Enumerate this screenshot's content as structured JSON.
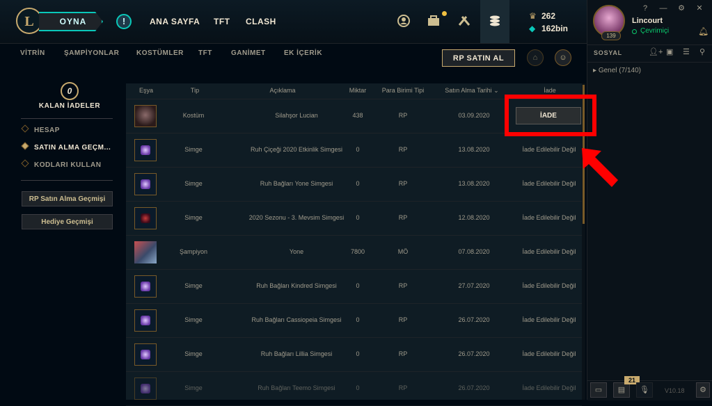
{
  "topbar": {
    "logo_letter": "L",
    "play_label": "OYNA",
    "alert_symbol": "!",
    "nav": [
      "ANA SAYFA",
      "TFT",
      "CLASH"
    ],
    "icons": [
      "profile-icon",
      "collection-icon",
      "loot-icon",
      "store-icon"
    ],
    "currency": {
      "blue_essence": "262",
      "rp": "162bin"
    }
  },
  "profile": {
    "name": "Lincourt",
    "status": "Çevrimiçi",
    "level": "139",
    "sys_buttons": [
      "?",
      "—",
      "⚙",
      "✕"
    ]
  },
  "subnav": {
    "items": [
      "VİTRİN",
      "ŞAMPİYONLAR",
      "KOSTÜMLER",
      "TFT",
      "GANİMET",
      "EK İÇERİK"
    ],
    "buy_rp": "RP SATIN AL"
  },
  "social": {
    "title": "SOSYAL",
    "group": "Genel (7/140)",
    "badge_count": "21",
    "version": "V10.18"
  },
  "left": {
    "refund_count": "0",
    "refund_label": "KALAN İADELER",
    "nav": [
      {
        "label": "HESAP"
      },
      {
        "label": "SATIN ALMA GEÇM..."
      },
      {
        "label": "KODLARI KULLAN"
      }
    ],
    "buttons": [
      "RP Satın Alma Geçmişi",
      "Hediye Geçmişi"
    ]
  },
  "table": {
    "headers": [
      "Eşya",
      "Tip",
      "Açıklama",
      "Miktar",
      "Para Birimi Tipi",
      "Satın Alma Tarihi",
      "İade"
    ],
    "refund_button": "İADE",
    "rows": [
      {
        "thumb": "skin",
        "type": "Kostüm",
        "desc": "Silahşor Lucian",
        "amount": "438",
        "currency": "RP",
        "date": "03.09.2020",
        "status": ""
      },
      {
        "thumb": "icon",
        "type": "Simge",
        "desc": "Ruh Çiçeği 2020 Etkinlik Simgesi",
        "amount": "0",
        "currency": "RP",
        "date": "13.08.2020",
        "status": "İade Edilebilir Değil"
      },
      {
        "thumb": "icon",
        "type": "Simge",
        "desc": "Ruh Bağları Yone Simgesi",
        "amount": "0",
        "currency": "RP",
        "date": "13.08.2020",
        "status": "İade Edilebilir Değil"
      },
      {
        "thumb": "icon red",
        "type": "Simge",
        "desc": "2020 Sezonu - 3. Mevsim Simgesi",
        "amount": "0",
        "currency": "RP",
        "date": "12.08.2020",
        "status": "İade Edilebilir Değil"
      },
      {
        "thumb": "champ",
        "type": "Şampiyon",
        "desc": "Yone",
        "amount": "7800",
        "currency": "MÖ",
        "date": "07.08.2020",
        "status": "İade Edilebilir Değil"
      },
      {
        "thumb": "icon",
        "type": "Simge",
        "desc": "Ruh Bağları Kindred Simgesi",
        "amount": "0",
        "currency": "RP",
        "date": "27.07.2020",
        "status": "İade Edilebilir Değil"
      },
      {
        "thumb": "icon",
        "type": "Simge",
        "desc": "Ruh Bağları Cassiopeia Simgesi",
        "amount": "0",
        "currency": "RP",
        "date": "26.07.2020",
        "status": "İade Edilebilir Değil"
      },
      {
        "thumb": "icon",
        "type": "Simge",
        "desc": "Ruh Bağları Lillia Simgesi",
        "amount": "0",
        "currency": "RP",
        "date": "26.07.2020",
        "status": "İade Edilebilir Değil"
      },
      {
        "thumb": "icon",
        "type": "Simge",
        "desc": "Ruh Bağları Teemo Simgesi",
        "amount": "0",
        "currency": "RP",
        "date": "26.07.2020",
        "status": "İade Edilebilir Değil"
      }
    ]
  },
  "colors": {
    "gold": "#c8aa6e",
    "teal": "#0ac8b9",
    "annotation_red": "#ff0000"
  }
}
